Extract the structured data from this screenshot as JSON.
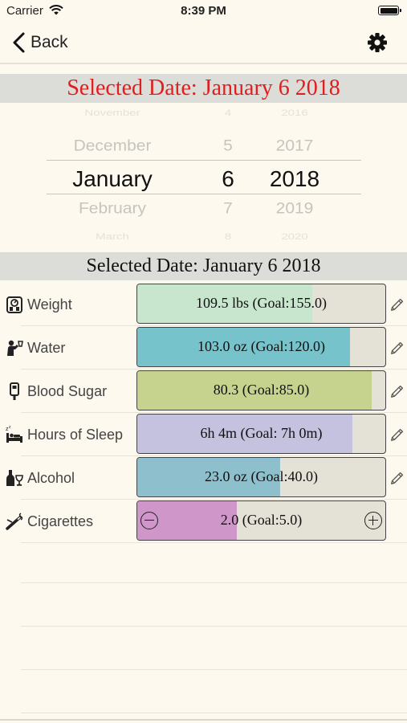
{
  "status": {
    "carrier": "Carrier",
    "time": "8:39 PM"
  },
  "nav": {
    "back_label": "Back"
  },
  "header": {
    "selected_date_red": "Selected Date: January 6 2018",
    "selected_date": "Selected Date: January 6 2018"
  },
  "picker": {
    "months": [
      "November",
      "December",
      "January",
      "February",
      "March"
    ],
    "days": [
      "4",
      "5",
      "6",
      "7",
      "8"
    ],
    "years": [
      "2016",
      "2017",
      "2018",
      "2019",
      "2020"
    ],
    "selected_index": 2
  },
  "metrics": [
    {
      "name": "Weight",
      "value": "109.5 lbs (Goal:155.0)",
      "progress": 0.706,
      "color": "#c7e6cd",
      "icon": "scale-icon",
      "edit_icon": "pencil-icon"
    },
    {
      "name": "Water",
      "value": "103.0 oz (Goal:120.0)",
      "progress": 0.858,
      "color": "#76c3cb",
      "icon": "water-drinker-icon",
      "edit_icon": "pencil-icon"
    },
    {
      "name": "Blood Sugar",
      "value": "80.3  (Goal:85.0)",
      "progress": 0.945,
      "color": "#c5d38f",
      "icon": "glucose-meter-icon",
      "edit_icon": "pencil-icon"
    },
    {
      "name": "Hours of Sleep",
      "value": "6h 4m  (Goal: 7h 0m)",
      "progress": 0.866,
      "color": "#c4c2de",
      "icon": "bed-icon",
      "edit_icon": "pencil-icon"
    },
    {
      "name": "Alcohol",
      "value": "23.0 oz (Goal:40.0)",
      "progress": 0.575,
      "color": "#8dc0cc",
      "icon": "wine-bottle-icon",
      "edit_icon": "pencil-icon"
    },
    {
      "name": "Cigarettes",
      "value": "2.0  (Goal:5.0)",
      "progress": 0.4,
      "color": "#cf97c9",
      "icon": "cigarette-icon",
      "minus_icon": "minus-circle-icon",
      "plus_icon": "plus-circle-icon"
    }
  ]
}
